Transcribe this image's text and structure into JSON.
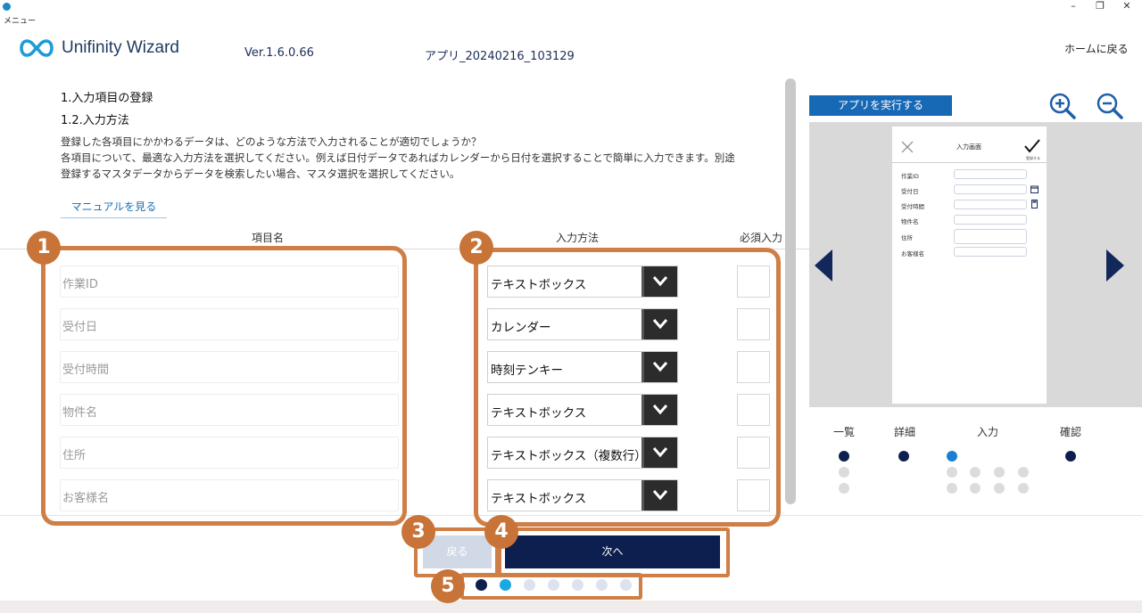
{
  "window": {
    "title": "メニュー",
    "controls": {
      "minimize": "–",
      "restore": "❐",
      "close": "✕"
    }
  },
  "header": {
    "brand": "Unifinity Wizard",
    "version": "Ver.1.6.0.66",
    "app_name": "アプリ_20240216_103129",
    "home_link": "ホームに戻る"
  },
  "main": {
    "heading1": "1.入力項目の登録",
    "heading2": "1.2.入力方法",
    "description": [
      "登録した各項目にかかわるデータは、どのような方法で入力されることが適切でしょうか？",
      "各項目について、最適な入力方法を選択してください。例えば日付データであればカレンダーから日付を選択することで簡単に入力できます。別途",
      "登録するマスタデータからデータを検索したい場合、マスタ選択を選択してください。"
    ],
    "manual_link": "マニュアルを見る",
    "columns": {
      "item_name": "項目名",
      "input_method": "入力方法",
      "required": "必須入力"
    },
    "rows": [
      {
        "name": "作業ID",
        "method": "テキストボックス",
        "required": false
      },
      {
        "name": "受付日",
        "method": "カレンダー",
        "required": false
      },
      {
        "name": "受付時間",
        "method": "時刻テンキー",
        "required": false
      },
      {
        "name": "物件名",
        "method": "テキストボックス",
        "required": false
      },
      {
        "name": "住所",
        "method": "テキストボックス（複数行）",
        "required": false
      },
      {
        "name": "お客様名",
        "method": "テキストボックス",
        "required": false
      }
    ]
  },
  "callouts": [
    "1",
    "2",
    "3",
    "4",
    "5"
  ],
  "footer": {
    "back_label": "戻る",
    "next_label": "次へ",
    "steps_total": 7,
    "current_step": 2
  },
  "preview": {
    "run_button": "アプリを実行する",
    "zoom_in_icon": "zoom-in-icon",
    "zoom_out_icon": "zoom-out-icon",
    "screen_title": "入力画面",
    "submit_label": "登録する",
    "fields": [
      "作業ID",
      "受付日",
      "受付時間",
      "物件名",
      "住所",
      "お客様名"
    ],
    "flow": {
      "labels": [
        "一覧",
        "詳細",
        "入力",
        "確認"
      ]
    }
  },
  "colors": {
    "navy": "#0d1f4f",
    "accent_blue": "#1769b5",
    "callout_orange": "#cf7f45"
  }
}
